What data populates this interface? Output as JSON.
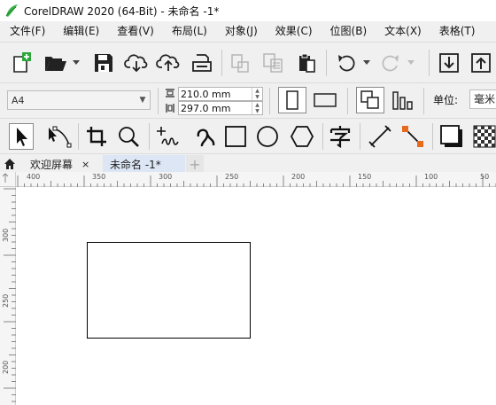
{
  "window": {
    "title": "CorelDRAW 2020 (64-Bit) - 未命名 -1*",
    "logo_icon": "coreldraw-logo-icon"
  },
  "menu": [
    "文件(F)",
    "编辑(E)",
    "查看(V)",
    "布局(L)",
    "对象(J)",
    "效果(C)",
    "位图(B)",
    "文本(X)",
    "表格(T)"
  ],
  "standard_toolbar": {
    "icons": [
      "new-document-icon",
      "open-icon",
      "save-icon",
      "cloud-download-icon",
      "cloud-upload-icon",
      "print-icon",
      "copy-format-icon",
      "paste-format-icon",
      "clipboard-icon",
      "undo-icon",
      "redo-icon",
      "import-icon",
      "export-icon"
    ]
  },
  "property_bar": {
    "page_size": "A4",
    "width": "210.0 mm",
    "height": "297.0 mm",
    "unit_label": "单位:",
    "unit_value": "毫米"
  },
  "toolbox": {
    "icons": [
      "pick-tool-icon",
      "shape-tool-icon",
      "crop-tool-icon",
      "zoom-tool-icon",
      "freehand-tool-icon",
      "artistic-media-icon",
      "rectangle-tool-icon",
      "ellipse-tool-icon",
      "polygon-tool-icon",
      "text-tool-icon",
      "dimension-tool-icon",
      "connector-tool-icon",
      "drop-shadow-icon",
      "transparency-icon"
    ]
  },
  "tabs": {
    "home_icon": "home-icon",
    "welcome": "欢迎屏幕",
    "close_symbol": "×",
    "document": "未命名 -1*",
    "add_symbol": "+"
  },
  "ruler": {
    "horizontal_labels": [
      "400",
      "350",
      "300",
      "250",
      "200",
      "150",
      "100",
      "50"
    ],
    "vertical_labels": [
      "300",
      "250",
      "200"
    ]
  },
  "colors": {
    "chrome_bg": "#f0f0f0",
    "active_tab": "#dce6f4",
    "accent_orange": "#e8681c",
    "logo_green": "#39b54a"
  }
}
